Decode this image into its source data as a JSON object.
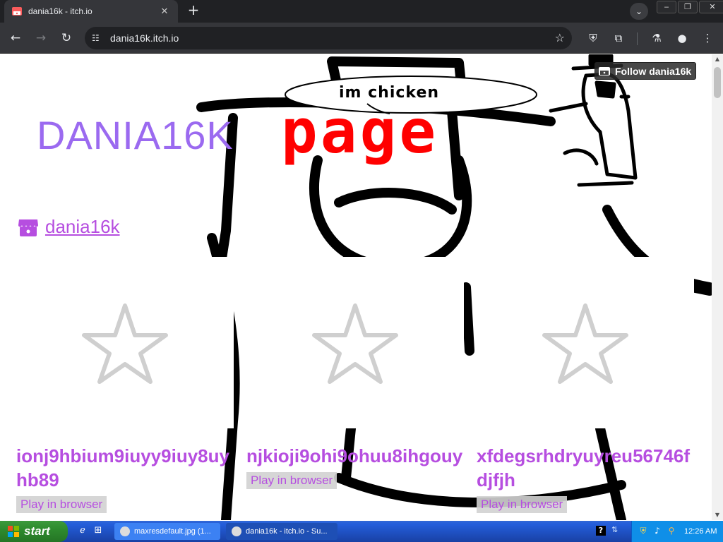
{
  "browser": {
    "tab_title": "dania16k - itch.io",
    "tab_close": "✕",
    "new_tab": "+",
    "address": "dania16k.itch.io",
    "window_controls": [
      "‒",
      "❐",
      "✕"
    ]
  },
  "page": {
    "heading_left": "DANIA16K",
    "heading_right": "page",
    "speech_bubble": "im chicken",
    "follow_label": "Follow dania16k",
    "user_name": "dania16k",
    "games": [
      {
        "title": "ionj9hbium9iuyy9iuy8uyhb89",
        "platform": "Play in browser"
      },
      {
        "title": "njkioji9ohi9ohuu8ihgouy",
        "platform": "Play in browser"
      },
      {
        "title": "xfdegsrhdryuyreu56746fdjfjh",
        "platform": "Play in browser"
      }
    ]
  },
  "taskbar": {
    "start_label": "start",
    "items": [
      "maxresdefault.jpg (1...",
      "dania16k - itch.io - Su..."
    ],
    "clock": "12:26 AM"
  },
  "colors": {
    "accent": "#b64ee0",
    "heading_purple": "#9b6af0",
    "heading_red": "#ff0000",
    "browser_dark": "#202124",
    "browser_toolbar": "#35363a"
  }
}
